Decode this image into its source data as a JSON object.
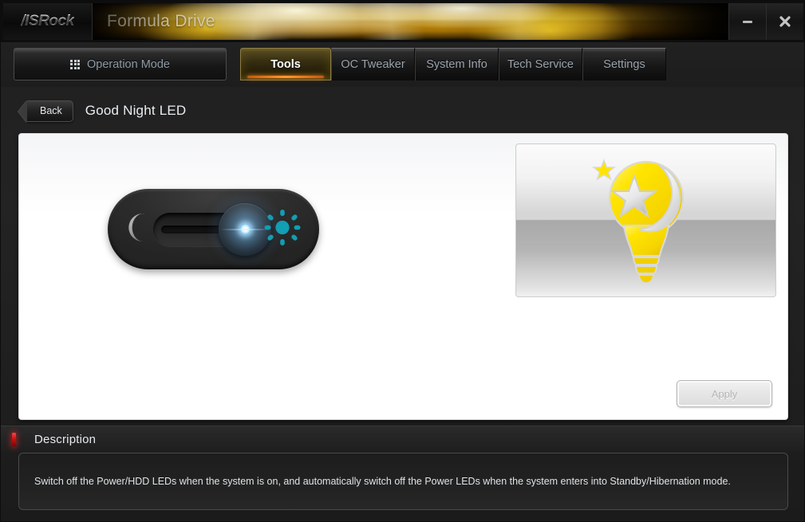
{
  "window": {
    "brand": "/ISRock",
    "app_title": "Formula Drive",
    "minimize_label": "minimize",
    "close_label": "close"
  },
  "tabs": [
    {
      "label": "Operation Mode",
      "icon": "grid-icon",
      "active": false
    },
    {
      "label": "Tools",
      "active": true
    },
    {
      "label": "OC Tweaker",
      "active": false
    },
    {
      "label": "System Info",
      "active": false
    },
    {
      "label": "Tech Service",
      "active": false
    },
    {
      "label": "Settings",
      "active": false
    }
  ],
  "breadcrumb": {
    "back_label": "Back",
    "page_title": "Good Night LED"
  },
  "main": {
    "toggle": {
      "name": "good-night-led-toggle",
      "state": "on",
      "left_icon": "moon-icon",
      "right_icon": "sun-icon",
      "led_color": "#9fd8f8"
    },
    "preview": {
      "image_name": "lightbulb-moon-star-illustration",
      "bulb_color": "#ffe400",
      "accent_color": "#d9d9d9"
    },
    "apply_button": {
      "label": "Apply",
      "enabled": false
    }
  },
  "description": {
    "indicator": "red-led-indicator",
    "title": "Description",
    "text": "Switch off the Power/HDD LEDs when the system is on, and automatically switch off the Power LEDs when the system enters into Standby/Hibernation mode."
  },
  "colors": {
    "accent_orange": "#ff9a2e",
    "banner_gold": "#d4b02c",
    "toggle_teal": "#1a9fb2",
    "status_red": "#cc1111"
  }
}
